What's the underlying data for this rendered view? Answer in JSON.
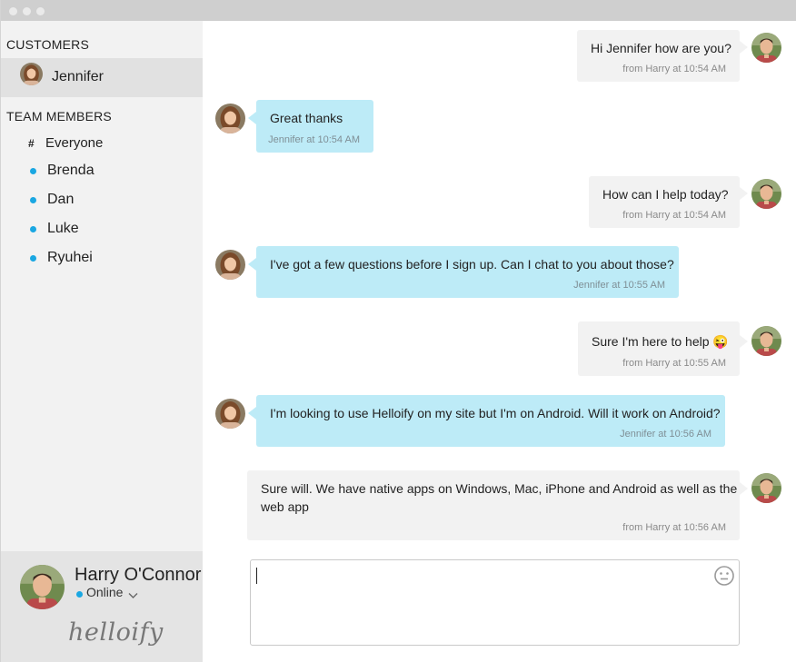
{
  "sidebar": {
    "customers_title": "CUSTOMERS",
    "customer": {
      "name": "Jennifer"
    },
    "team_title": "TEAM MEMBERS",
    "team": [
      {
        "label": "Everyone",
        "kind": "channel",
        "marker": "#"
      },
      {
        "label": "Brenda",
        "kind": "member",
        "status_color": "#1aa7e2"
      },
      {
        "label": "Dan",
        "kind": "member",
        "status_color": "#1aa7e2"
      },
      {
        "label": "Luke",
        "kind": "member",
        "status_color": "#1aa7e2"
      },
      {
        "label": "Ryuhei",
        "kind": "member",
        "status_color": "#1aa7e2"
      }
    ],
    "profile": {
      "name": "Harry O'Connor",
      "status": "Online",
      "status_color": "#1aa7e2",
      "logo": "helloify"
    }
  },
  "messages": [
    {
      "text": "Hi Jennifer how are you?",
      "meta": "from Harry at 10:54 AM",
      "direction": "out"
    },
    {
      "text": "Great thanks",
      "meta": "Jennifer at 10:54 AM",
      "direction": "in"
    },
    {
      "text": "How can I help today?",
      "meta": "from Harry at 10:54 AM",
      "direction": "out"
    },
    {
      "text": "I've got a few questions before I sign up. Can I chat to you about those?",
      "meta": "Jennifer at 10:55 AM",
      "direction": "in"
    },
    {
      "text": "Sure I'm here to help",
      "emoji": "😜",
      "meta": "from Harry at 10:55 AM",
      "direction": "out"
    },
    {
      "text": "I'm looking to use Helloify on my site but I'm on Android. Will it work on Android?",
      "meta": "Jennifer at 10:56 AM",
      "direction": "in"
    },
    {
      "text": "Sure will. We have native apps on Windows, Mac, iPhone and Android as well as the",
      "text2": "web app",
      "meta": "from Harry at 10:56 AM",
      "direction": "out"
    }
  ],
  "composer": {
    "value": "",
    "emoji_icon": "neutral-face-icon"
  },
  "colors": {
    "accent": "#1aa7e2",
    "incoming_bubble": "#bdebf7",
    "outgoing_bubble": "#f2f2f2",
    "sidebar_bg": "#f2f2f2",
    "selected_row": "#e1e1e1"
  }
}
